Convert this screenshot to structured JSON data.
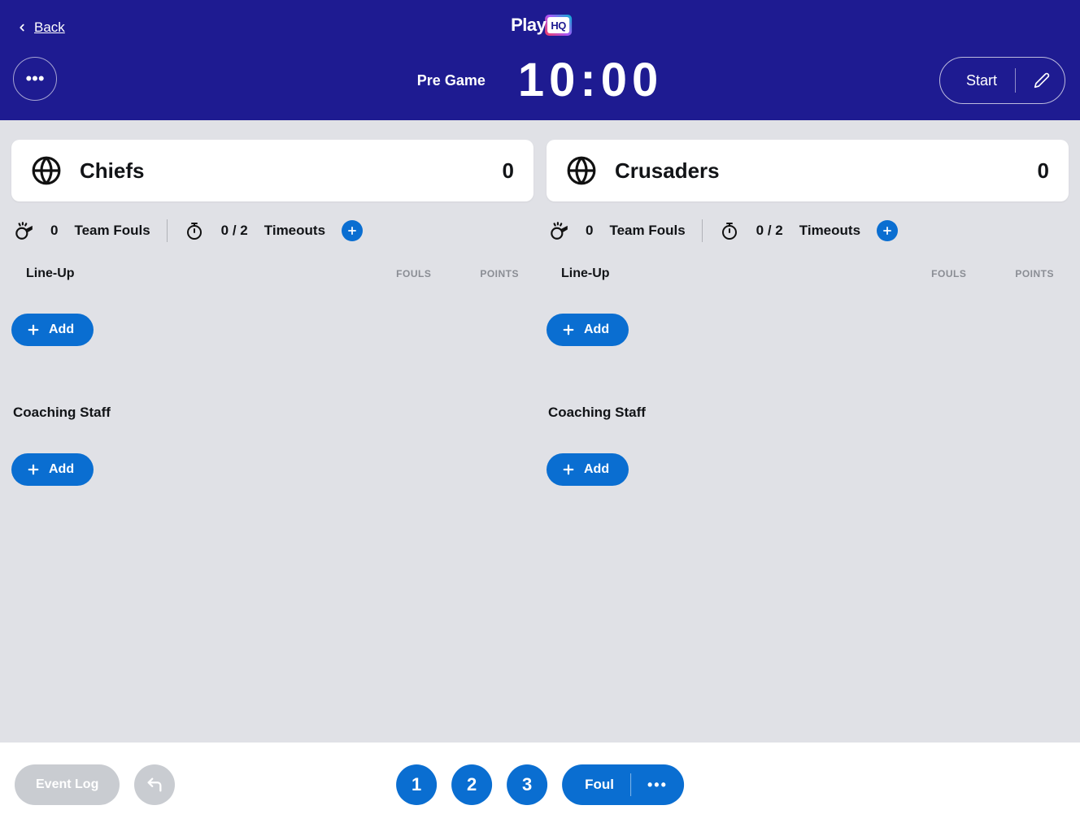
{
  "header": {
    "back_label": "Back",
    "logo_main": "Play",
    "logo_badge": "HQ",
    "pre_game_label": "Pre Game",
    "clock": "10:00",
    "start_label": "Start"
  },
  "teams": [
    {
      "name": "Chiefs",
      "score": "0",
      "team_fouls_value": "0",
      "team_fouls_label": "Team Fouls",
      "timeouts_value": "0 / 2",
      "timeouts_label": "Timeouts",
      "lineup_label": "Line-Up",
      "fouls_col": "FOULS",
      "points_col": "POINTS",
      "add_lineup_label": "Add",
      "coaching_label": "Coaching Staff",
      "add_coach_label": "Add"
    },
    {
      "name": "Crusaders",
      "score": "0",
      "team_fouls_value": "0",
      "team_fouls_label": "Team Fouls",
      "timeouts_value": "0 / 2",
      "timeouts_label": "Timeouts",
      "lineup_label": "Line-Up",
      "fouls_col": "FOULS",
      "points_col": "POINTS",
      "add_lineup_label": "Add",
      "coaching_label": "Coaching Staff",
      "add_coach_label": "Add"
    }
  ],
  "footer": {
    "event_log_label": "Event Log",
    "score_buttons": [
      "1",
      "2",
      "3"
    ],
    "foul_label": "Foul"
  }
}
